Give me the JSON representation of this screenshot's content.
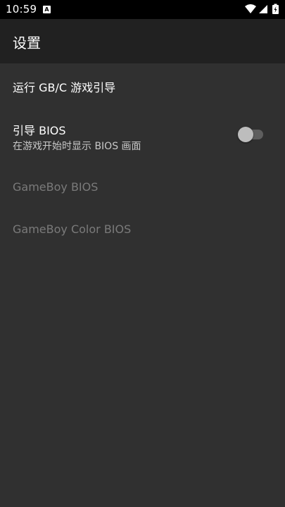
{
  "status_bar": {
    "time": "10:59",
    "notification_icon": "A",
    "icons": [
      "wifi-icon",
      "cellular-icon",
      "battery-icon"
    ]
  },
  "app_bar": {
    "title": "设置"
  },
  "preferences": [
    {
      "title": "运行 GB/C 游戏引导",
      "enabled": true
    },
    {
      "title": "引导 BIOS",
      "summary": "在游戏开始时显示 BIOS 画面",
      "enabled": true,
      "toggle_on": false
    },
    {
      "title": "GameBoy BIOS",
      "enabled": false
    },
    {
      "title": "GameBoy Color BIOS",
      "enabled": false
    }
  ],
  "colors": {
    "status_bar": "#000000",
    "app_bar": "#212121",
    "background": "#303030",
    "text_primary": "#ffffff",
    "text_secondary": "#c8c8c8",
    "text_disabled": "#7a7a7a"
  }
}
